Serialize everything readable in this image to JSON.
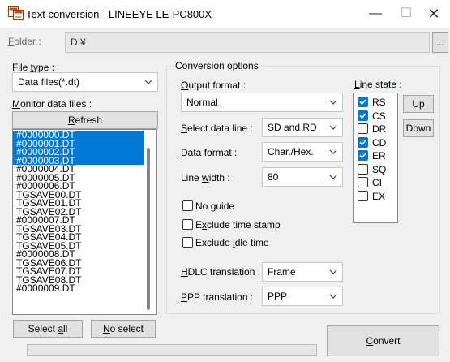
{
  "window": {
    "title": "Text conversion - LINEEYE LE-PC800X",
    "minimize": "—",
    "maximize": "☐",
    "close": "✕"
  },
  "folder": {
    "label_u": "F",
    "label_rest": "older :",
    "value": "D:¥",
    "browse": "..."
  },
  "file_type": {
    "label_pre": "File ",
    "label_u": "t",
    "label_rest": "ype :",
    "value": "Data files(*.dt)"
  },
  "monitor": {
    "label_u": "M",
    "label_rest": "onitor data files :",
    "refresh_u": "R",
    "refresh_rest": "efresh"
  },
  "files": [
    {
      "name": "#0000000.DT",
      "selected": true
    },
    {
      "name": "#0000001.DT",
      "selected": true
    },
    {
      "name": "#0000002.DT",
      "selected": true
    },
    {
      "name": "#0000003.DT",
      "selected": true
    },
    {
      "name": "#0000004.DT",
      "selected": false
    },
    {
      "name": "#0000005.DT",
      "selected": false
    },
    {
      "name": "#0000006.DT",
      "selected": false
    },
    {
      "name": "TGSAVE00.DT",
      "selected": false
    },
    {
      "name": "TGSAVE01.DT",
      "selected": false
    },
    {
      "name": "TGSAVE02.DT",
      "selected": false
    },
    {
      "name": "#0000007.DT",
      "selected": false
    },
    {
      "name": "TGSAVE03.DT",
      "selected": false
    },
    {
      "name": "TGSAVE04.DT",
      "selected": false
    },
    {
      "name": "TGSAVE05.DT",
      "selected": false
    },
    {
      "name": "#0000008.DT",
      "selected": false
    },
    {
      "name": "TGSAVE06.DT",
      "selected": false
    },
    {
      "name": "TGSAVE07.DT",
      "selected": false
    },
    {
      "name": "TGSAVE08.DT",
      "selected": false
    },
    {
      "name": "#0000009.DT",
      "selected": false
    }
  ],
  "select_all": {
    "pre": "Select ",
    "u": "a",
    "rest": "ll"
  },
  "no_select": {
    "u": "N",
    "rest": "o select"
  },
  "conversion": {
    "title": "Conversion options",
    "output_format": {
      "u": "O",
      "rest": "utput format :",
      "value": "Normal"
    },
    "data_line": {
      "u": "S",
      "rest": "elect data line :",
      "value": "SD and RD"
    },
    "data_format": {
      "u": "D",
      "rest": "ata format :",
      "value": "Char./Hex."
    },
    "line_width": {
      "pre": "Line ",
      "u": "w",
      "rest": "idth :",
      "value": "80"
    },
    "no_guide": {
      "pre": "No ",
      "u": "g",
      "rest": "uide",
      "checked": false
    },
    "exclude_time": {
      "pre": "E",
      "u": "x",
      "rest": "clude time stamp",
      "checked": false
    },
    "exclude_idle": {
      "pre": "Exclude ",
      "u": "i",
      "rest": "dle time",
      "checked": false
    },
    "hdlc": {
      "u": "H",
      "rest": "DLC translation :",
      "value": "Frame"
    },
    "ppp": {
      "u": "P",
      "rest": "PP translation :",
      "value": "PPP"
    },
    "line_state": {
      "label_u": "L",
      "label_rest": "ine state :",
      "items": [
        {
          "label": "RS",
          "checked": true
        },
        {
          "label": "CS",
          "checked": true
        },
        {
          "label": "DR",
          "checked": false
        },
        {
          "label": "CD",
          "checked": true
        },
        {
          "label": "ER",
          "checked": true
        },
        {
          "label": "SQ",
          "checked": false
        },
        {
          "label": "CI",
          "checked": false
        },
        {
          "label": "EX",
          "checked": false
        }
      ],
      "up": "Up",
      "down": "Down"
    }
  },
  "convert": {
    "u": "C",
    "rest": "onvert"
  },
  "progress": {
    "fraction": 0
  },
  "colors": {
    "accent": "#0078d7",
    "window_bg": "#f0f0f0"
  }
}
